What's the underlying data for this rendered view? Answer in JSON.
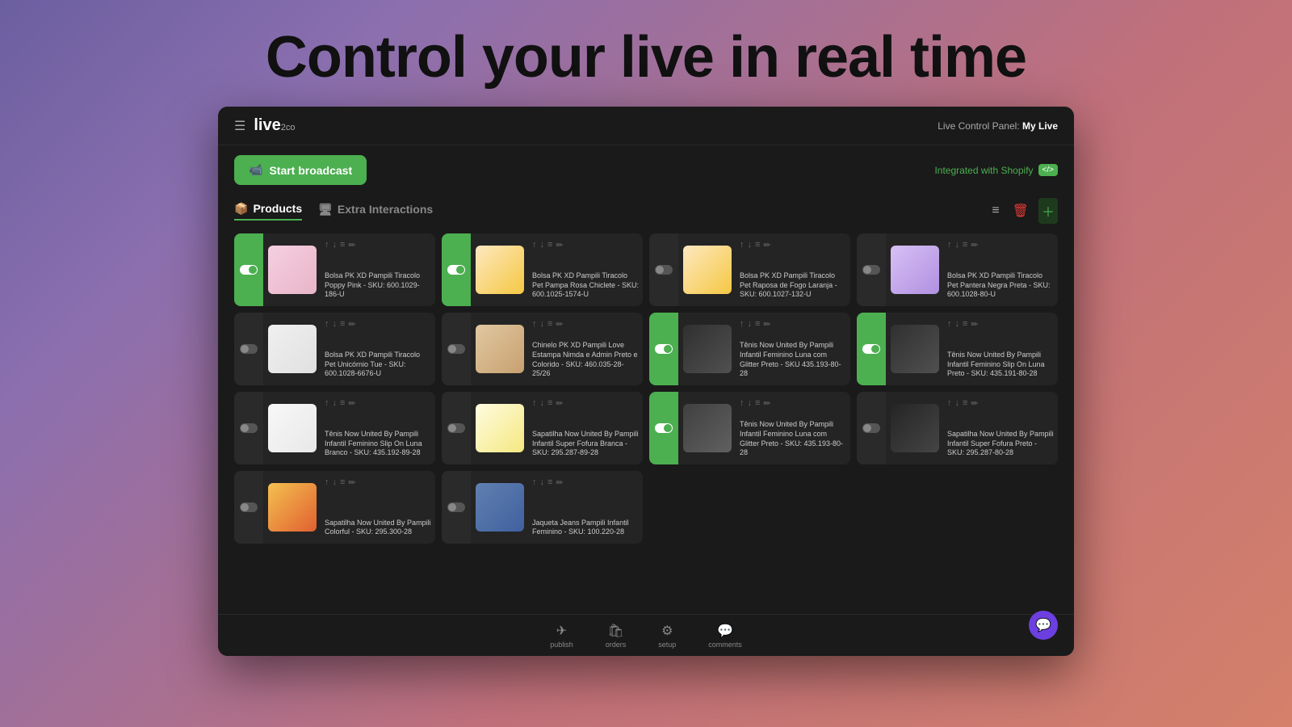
{
  "hero": {
    "title": "Control your live in real time"
  },
  "header": {
    "title": "Live Control Panel:",
    "live_name": "My Live",
    "logo": "live",
    "logo_suffix": "2co"
  },
  "toolbar": {
    "start_broadcast": "Start broadcast",
    "shopify_label": "Integrated with Shopify"
  },
  "tabs": [
    {
      "label": "Products",
      "active": true,
      "icon": "📦"
    },
    {
      "label": "Extra Interactions",
      "active": false,
      "icon": "🖥"
    }
  ],
  "products": [
    {
      "id": 1,
      "active": true,
      "title": "Bolsa PK XD Pampili Tiracolo Poppy Pink - SKU: 600.1029-186-U",
      "img_class": "img-bag-pink"
    },
    {
      "id": 2,
      "active": true,
      "title": "Bolsa PK XD Pampili Tiracolo Pet Pampa Rosa Chiclete - SKU: 600.1025-1574-U",
      "img_class": "img-bag-orange"
    },
    {
      "id": 3,
      "active": false,
      "title": "Bolsa PK XD Pampili Tiracolo Pet Raposa de Fogo Laranja - SKU: 600.1027-132-U",
      "img_class": "img-bag-orange"
    },
    {
      "id": 4,
      "active": false,
      "title": "Bolsa PK XD Pampili Tiracolo Pet Pantera Negra Preta - SKU: 600.1028-80-U",
      "img_class": "img-bag-purple"
    },
    {
      "id": 5,
      "active": false,
      "title": "Bolsa PK XD Pampili Tiracolo Pet Unicórnio Tue - SKU: 600.1028-6676-U",
      "img_class": "img-shoe-cat"
    },
    {
      "id": 6,
      "active": false,
      "title": "Chinelo PK XD Pampili Love Estampa Nimda e Admin Preto e Colorido - SKU: 460.035-28-25/26",
      "img_class": "img-sandal"
    },
    {
      "id": 7,
      "active": true,
      "title": "Tênis Now United By Pampili Infantil Feminino Luna com Glitter Preto - SKU 435.193-80-28",
      "img_class": "img-shoe-black"
    },
    {
      "id": 8,
      "active": true,
      "title": "Tênis Now United By Pampili Infantil Feminino Slip On Luna Preto - SKU: 435.191-80-28",
      "img_class": "img-shoe-black"
    },
    {
      "id": 9,
      "active": false,
      "title": "Tênis Now United By Pampili Infantil Feminino Slip On Luna Branco - SKU: 435.192-89-28",
      "img_class": "img-shoe-white"
    },
    {
      "id": 10,
      "active": false,
      "title": "Sapatilha Now United By Pampili Infantil Super Fofura Branca - SKU: 295.287-89-28",
      "img_class": "img-sandal-white"
    },
    {
      "id": 11,
      "active": true,
      "title": "Tênis Now United By Pampili Infantil Feminino Luna com Glitter Preto - SKU: 435.193-80-28",
      "img_class": "img-shoe-glitter"
    },
    {
      "id": 12,
      "active": false,
      "title": "Sapatilha Now United By Pampili Infantil Super Fofura Preto - SKU: 295.287-80-28",
      "img_class": "img-sandal-black"
    },
    {
      "id": 13,
      "active": false,
      "title": "Sapatilha Now United By Pampili Colorful - SKU: 295.300-28",
      "img_class": "img-shoe-colorful"
    },
    {
      "id": 14,
      "active": false,
      "title": "Jaqueta Jeans Pampili Infantil Feminino - SKU: 100.220-28",
      "img_class": "img-jeans"
    }
  ],
  "bottom_nav": [
    {
      "label": "publish",
      "icon": "✈"
    },
    {
      "label": "orders",
      "icon": "🛍"
    },
    {
      "label": "setup",
      "icon": "⚙"
    },
    {
      "label": "comments",
      "icon": "💬"
    }
  ]
}
